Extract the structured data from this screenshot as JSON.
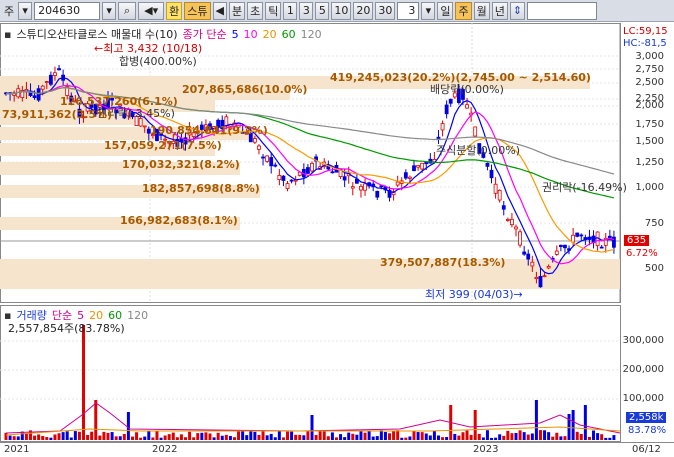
{
  "toolbar": {
    "market_label": "주",
    "code": "204630",
    "b_hwan": "환",
    "b_seucheu": "스튜",
    "b_bun": "분",
    "b_cho": "초",
    "b_tik": "틱",
    "periods": [
      "1",
      "3",
      "5",
      "10",
      "20",
      "30"
    ],
    "count_value": "3",
    "b_il": "일",
    "b_ju": "주",
    "b_wol": "월",
    "b_nyeon": "년"
  },
  "price_legend": {
    "stock_name": "스튜디오산타클로스 매물대 수(10)",
    "ma_title": "종가 단순",
    "ma": [
      "5",
      "10",
      "20",
      "60",
      "120"
    ],
    "ma_colors": [
      "#0000ff",
      "#ff00ff",
      "#ff9900",
      "#009900",
      "#888888"
    ]
  },
  "volume_legend": {
    "title": "거래량",
    "ma_title": "단순",
    "ma": [
      "5",
      "20",
      "60",
      "120"
    ],
    "vol_value": "2,557,854주(83.78%)"
  },
  "right_axis": {
    "lc": "LC:59,15",
    "hc": "HC:-81,5",
    "price_ticks": [
      "3,000",
      "2,750",
      "2,500",
      "2,250",
      "2,000",
      "1,750",
      "1,500",
      "1,250",
      "1,000",
      "750",
      "500"
    ],
    "current_price": "635",
    "change_pct": "6.72%",
    "vol_ticks": [
      "300,000",
      "200,000",
      "100,000"
    ],
    "vol_current": "2,558k",
    "vol_pct": "83.78%"
  },
  "x_axis": {
    "labels": [
      "2021",
      "2022",
      "2023",
      "06/12"
    ]
  },
  "annotations": {
    "high": "←최고 3,432 (10/18)",
    "low": "최저 399 (04/03)→",
    "merger": "합병(400.00%)",
    "rights_a": "권리락(-3.45%)",
    "div": "배당락(0.00%)",
    "rights_b": "권리락(-16.49%)",
    "split": "주식분할(0.00%)",
    "bands": [
      "419,245,023(20.2%)(2,745.00 ~ 2,514.60)",
      "207,865,686(10.0%)",
      "126,537,260(6.1%)",
      "73,911,362(3.5%)",
      "190,854,841(9.2%)",
      "157,059,271(7.5%)",
      "170,032,321(8.2%)",
      "182,857,698(8.8%)",
      "166,982,683(8.1%)",
      "379,507,887(18.3%)"
    ]
  },
  "chart_data": {
    "type": "candlestick",
    "y_range": [
      400,
      3300
    ],
    "x_labels": [
      "2021",
      "2022",
      "2023",
      "06/12"
    ],
    "high": {
      "value": 3432,
      "date": "10/18"
    },
    "low": {
      "value": 399,
      "date": "04/03"
    },
    "current": 635
  }
}
